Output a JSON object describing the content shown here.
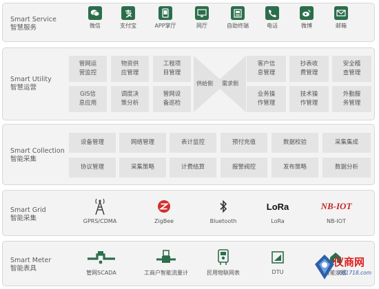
{
  "rows": {
    "service": {
      "en": "Smart Service",
      "cn": "智慧服务",
      "items": [
        {
          "label": "微信",
          "icon": "wechat-icon"
        },
        {
          "label": "支付宝",
          "icon": "alipay-icon"
        },
        {
          "label": "APP掌厅",
          "icon": "app-icon"
        },
        {
          "label": "网厅",
          "icon": "monitor-icon"
        },
        {
          "label": "自助终端",
          "icon": "terminal-icon"
        },
        {
          "label": "电话",
          "icon": "phone-icon"
        },
        {
          "label": "微博",
          "icon": "weibo-icon"
        },
        {
          "label": "邮箱",
          "icon": "mail-icon"
        }
      ]
    },
    "utility": {
      "en": "Smart Utility",
      "cn": "智慧运营",
      "left": [
        "管网运\n营监控",
        "物资供\n应管理",
        "工程项\n目管理",
        "GIS信\n息应用",
        "调度决\n策分析",
        "管网设\n备巡检"
      ],
      "supply": "供给侧",
      "demand": "需求侧",
      "right": [
        "客户信\n息管理",
        "抄表收\n费管理",
        "安全稽\n查管理",
        "业务操\n作管理",
        "技术操\n作管理",
        "外勤服\n务管理"
      ]
    },
    "collection": {
      "en": "Smart Collection",
      "cn": "智能采集",
      "cells": [
        "设备管理",
        "网络管理",
        "表计监控",
        "预付充值",
        "数据校验",
        "采集集成",
        "协议管理",
        "采集策略",
        "计费结算",
        "报警阀控",
        "发布策略",
        "数据分析"
      ]
    },
    "grid": {
      "en": "Smart Grid",
      "cn": "智能采集",
      "items": [
        {
          "label": "GPRS/CDMA",
          "icon": "antenna-icon"
        },
        {
          "label": "ZigBee",
          "icon": "zigbee-icon"
        },
        {
          "label": "Bluetooth",
          "icon": "bluetooth-icon"
        },
        {
          "label": "LoRa",
          "icon": "lora-icon",
          "logo": "LoRa"
        },
        {
          "label": "NB-IOT",
          "icon": "nbiot-icon",
          "logo": "NB-IOT"
        }
      ]
    },
    "meter": {
      "en": "Smart Meter",
      "cn": "智能表具",
      "items": [
        {
          "label": "管网SCADA",
          "icon": "pipeline-icon"
        },
        {
          "label": "工商户智能流量计",
          "icon": "flowmeter-icon"
        },
        {
          "label": "民用物联网表",
          "icon": "meter-icon"
        },
        {
          "label": "DTU",
          "icon": "dtu-icon"
        },
        {
          "label": "智能家居",
          "icon": "smart-home-icon"
        }
      ]
    }
  },
  "watermark": {
    "brand": "仪商网",
    "url": "861718.com"
  },
  "colors": {
    "accent": "#2c6e4c",
    "panel": "#f3f3f3",
    "cell": "#e4e4e4",
    "watermark": "#e02020"
  }
}
